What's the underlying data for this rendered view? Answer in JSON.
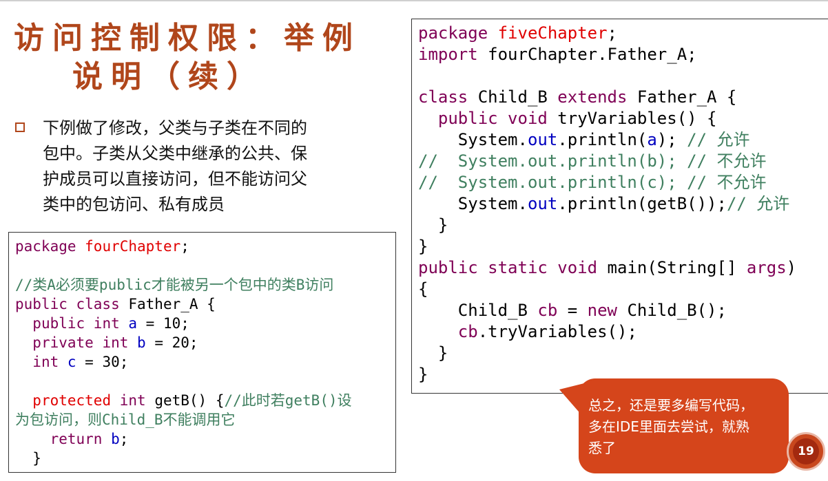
{
  "slide": {
    "title_line1": "访问控制权限：举例",
    "title_line2": "说明（续）",
    "bullet_lines": [
      "下例做了修改，父类与子类在不同的",
      "包中。子类从父类中继承的公共、保",
      "护成员可以直接访问，但不能访问父",
      "类中的包访问、私有成员"
    ],
    "callout_lines": [
      "总之，还是要多编写代码，",
      "多在IDE里面去尝试，就熟",
      "悉了"
    ],
    "page_number": "19"
  },
  "colors": {
    "title": "#b0461b",
    "callout_bg": "#d5451b",
    "keyword": "#7f0055",
    "string_red": "#e00000",
    "field_blue": "#0000c0",
    "comment_green": "#3f7f5f"
  },
  "left_code": [
    [
      [
        "kw",
        "package "
      ],
      [
        "str",
        "fourChapter"
      ],
      [
        "tok",
        ";"
      ]
    ],
    [],
    [
      [
        "cm",
        "//类A必须要public才能被另一个包中的类B访问"
      ]
    ],
    [
      [
        "kw",
        "public class "
      ],
      [
        "tok",
        "Father_A {"
      ]
    ],
    [
      [
        "tok",
        "  "
      ],
      [
        "kw",
        "public int "
      ],
      [
        "fld",
        "a"
      ],
      [
        "tok",
        " = 10;"
      ]
    ],
    [
      [
        "tok",
        "  "
      ],
      [
        "kw",
        "private int "
      ],
      [
        "fld",
        "b"
      ],
      [
        "tok",
        " = 20;"
      ]
    ],
    [
      [
        "tok",
        "  "
      ],
      [
        "kw",
        "int "
      ],
      [
        "fld",
        "c"
      ],
      [
        "tok",
        " = 30;"
      ]
    ],
    [],
    [
      [
        "tok",
        "  "
      ],
      [
        "str",
        "protected "
      ],
      [
        "kw",
        "int "
      ],
      [
        "tok",
        "getB() {"
      ],
      [
        "cm",
        "//此时若getB()设"
      ]
    ],
    [
      [
        "cm",
        "为包访问，则Child_B不能调用它"
      ]
    ],
    [
      [
        "tok",
        "    "
      ],
      [
        "kw",
        "return "
      ],
      [
        "fld",
        "b"
      ],
      [
        "tok",
        ";"
      ]
    ],
    [
      [
        "tok",
        "  }"
      ]
    ]
  ],
  "right_code": [
    [
      [
        "kw",
        "package "
      ],
      [
        "str",
        "fiveChapter"
      ],
      [
        "tok",
        ";"
      ]
    ],
    [
      [
        "kw",
        "import "
      ],
      [
        "tok",
        "fourChapter.Father_A;"
      ]
    ],
    [],
    [
      [
        "kw",
        "class "
      ],
      [
        "tok",
        "Child_B "
      ],
      [
        "kw",
        "extends "
      ],
      [
        "tok",
        "Father_A {"
      ]
    ],
    [
      [
        "tok",
        "  "
      ],
      [
        "kw",
        "public void "
      ],
      [
        "tok",
        "tryVariables() {"
      ]
    ],
    [
      [
        "tok",
        "    System."
      ],
      [
        "fld",
        "out"
      ],
      [
        "tok",
        ".println("
      ],
      [
        "fld",
        "a"
      ],
      [
        "tok",
        ");"
      ],
      [
        "cm",
        " // 允许"
      ]
    ],
    [
      [
        "cm",
        "//  System.out.println(b); // 不允许"
      ]
    ],
    [
      [
        "cm",
        "//  System.out.println(c); // 不允许"
      ]
    ],
    [
      [
        "tok",
        "    System."
      ],
      [
        "fld",
        "out"
      ],
      [
        "tok",
        ".println(getB());"
      ],
      [
        "cm",
        "// 允许"
      ]
    ],
    [
      [
        "tok",
        "  }"
      ]
    ],
    [
      [
        "tok",
        "}"
      ]
    ],
    [
      [
        "kw",
        "public static void "
      ],
      [
        "tok",
        "main(String[] "
      ],
      [
        "kw",
        "args"
      ],
      [
        "tok",
        ")"
      ]
    ],
    [
      [
        "tok",
        "{"
      ]
    ],
    [
      [
        "tok",
        "    Child_B "
      ],
      [
        "kw",
        "cb"
      ],
      [
        "tok",
        " = "
      ],
      [
        "kw",
        "new "
      ],
      [
        "tok",
        "Child_B();"
      ]
    ],
    [
      [
        "tok",
        "    "
      ],
      [
        "kw",
        "cb"
      ],
      [
        "tok",
        ".tryVariables();"
      ]
    ],
    [
      [
        "tok",
        "  }"
      ]
    ],
    [
      [
        "tok",
        "}"
      ]
    ]
  ]
}
